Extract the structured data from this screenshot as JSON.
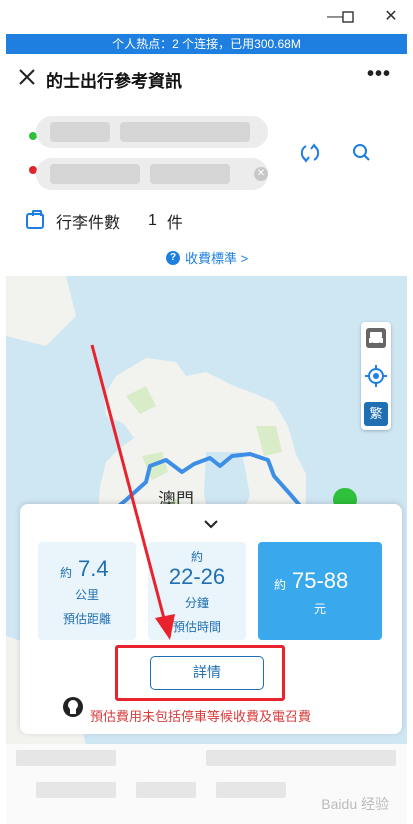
{
  "hotspot": {
    "text": "个人热点：2 个连接，已用300.68M"
  },
  "header": {
    "title": "的士出行參考資訊",
    "more": "•••"
  },
  "luggage": {
    "label": "行李件數",
    "count": "1",
    "unit": "件"
  },
  "fee_link": {
    "label": "收費標準 >"
  },
  "map": {
    "city_label": "澳門",
    "lang_toggle": "繁"
  },
  "estimate": {
    "distance": {
      "prefix": "約",
      "value": "7.4",
      "unit": "公里",
      "caption": "預估距離"
    },
    "time": {
      "prefix": "約",
      "value": "22-26",
      "unit": "分鐘",
      "caption": "預估時間"
    },
    "fare": {
      "prefix": "約",
      "value": "75-88",
      "unit": "元"
    },
    "details_label": "詳情",
    "note": "預估費用未包括停車等候收費及電召費"
  },
  "watermark": "Baidu 经验",
  "colors": {
    "accent": "#1f7fe0",
    "fare_bg": "#3aa8ec",
    "annotation": "#e8232e",
    "route": "#3c8ee6"
  }
}
